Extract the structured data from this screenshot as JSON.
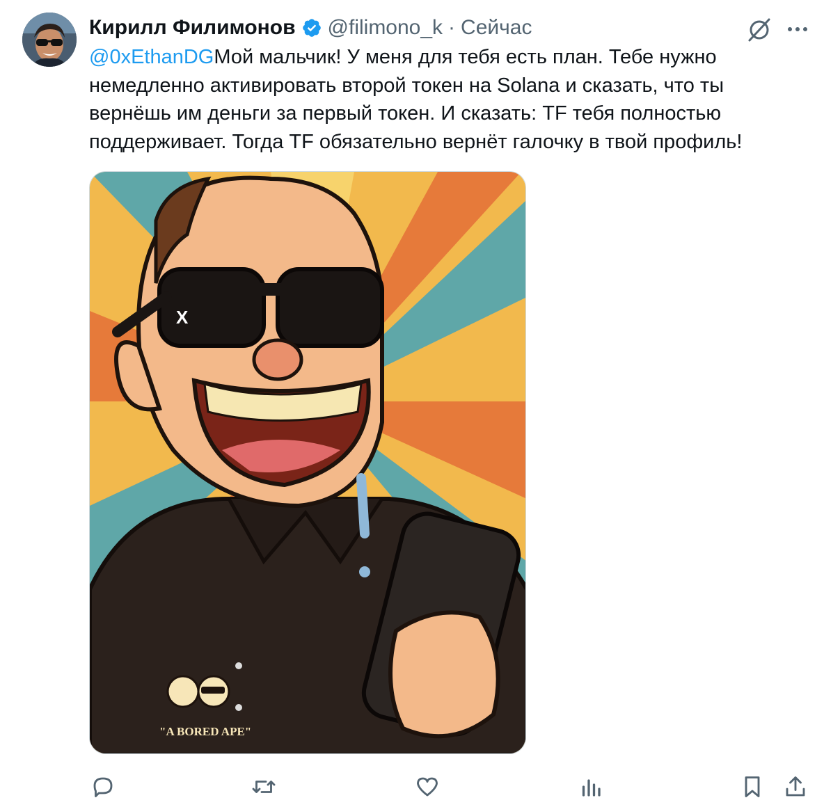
{
  "author": {
    "name": "Кирилл Филимонов",
    "handle": "@filimono_k",
    "separator": "·",
    "time": "Сейчас",
    "verified": true
  },
  "tweet": {
    "mention": "@0xEthanDG",
    "text": "Мой мальчик! У меня для тебя есть план. Тебе нужно немедленно активировать второй токен на Solana и сказать, что ты вернёшь им деньги за первый токен. И сказать: TF тебя полностью поддерживает. Тогда TF обязательно вернёт галочку в твой профиль!"
  },
  "media": {
    "shirt_label": "\"A BORED APE\"",
    "glasses_mark": "X"
  },
  "icons": {
    "verified": "verified-badge-icon",
    "grok": "grok-icon",
    "more": "more-icon",
    "reply": "reply-icon",
    "retweet": "retweet-icon",
    "like": "like-icon",
    "views": "views-icon",
    "bookmark": "bookmark-icon",
    "share": "share-icon"
  },
  "colors": {
    "accent": "#1d9bf0",
    "text": "#0f1419",
    "secondary": "#536471"
  }
}
